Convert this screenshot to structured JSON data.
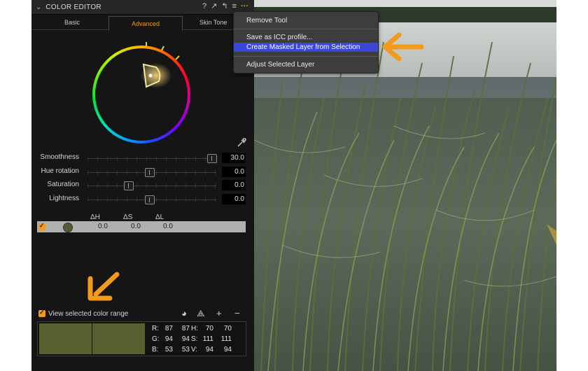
{
  "panel": {
    "title": "COLOR EDITOR",
    "header_icons": [
      "?",
      "↗",
      "↰",
      "≡",
      "···"
    ],
    "tabs": [
      {
        "label": "Basic"
      },
      {
        "label": "Advanced",
        "active": true
      },
      {
        "label": "Skin Tone"
      }
    ],
    "sliders": [
      {
        "label": "Smoothness",
        "value": "30.0",
        "level": 0.95
      },
      {
        "label": "Hue rotation",
        "value": "0.0",
        "level": 0.5
      },
      {
        "label": "Saturation",
        "value": "0.0",
        "level": 0.32
      },
      {
        "label": "Lightness",
        "value": "0.0",
        "level": 0.5
      }
    ],
    "delta_headers": [
      "ΔH",
      "ΔS",
      "ΔL"
    ],
    "color_row": {
      "values": [
        "0.0",
        "0.0",
        "0.0"
      ],
      "swatch": "#575a30"
    },
    "view_selected": {
      "label": "View selected color range",
      "checked": true
    },
    "swatch_color": "#57602f",
    "readout": {
      "row1": [
        "R:",
        "87",
        "87",
        "H:",
        "70",
        "70"
      ],
      "row2": [
        "G:",
        "94",
        "94",
        "S:",
        "111",
        "111"
      ],
      "row3": [
        "B:",
        "53",
        "53",
        "V:",
        "94",
        "94"
      ]
    }
  },
  "menu": {
    "items": [
      {
        "label": "Remove Tool"
      },
      {
        "label": "Save as ICC profile..."
      },
      {
        "label": "Create Masked Layer from Selection",
        "selected": true
      },
      {
        "label": "Adjust Selected Layer"
      }
    ]
  },
  "colors": {
    "accent": "#f29a1c",
    "menu_selected": "#3a47d8",
    "arrow": "#f39a1d"
  }
}
